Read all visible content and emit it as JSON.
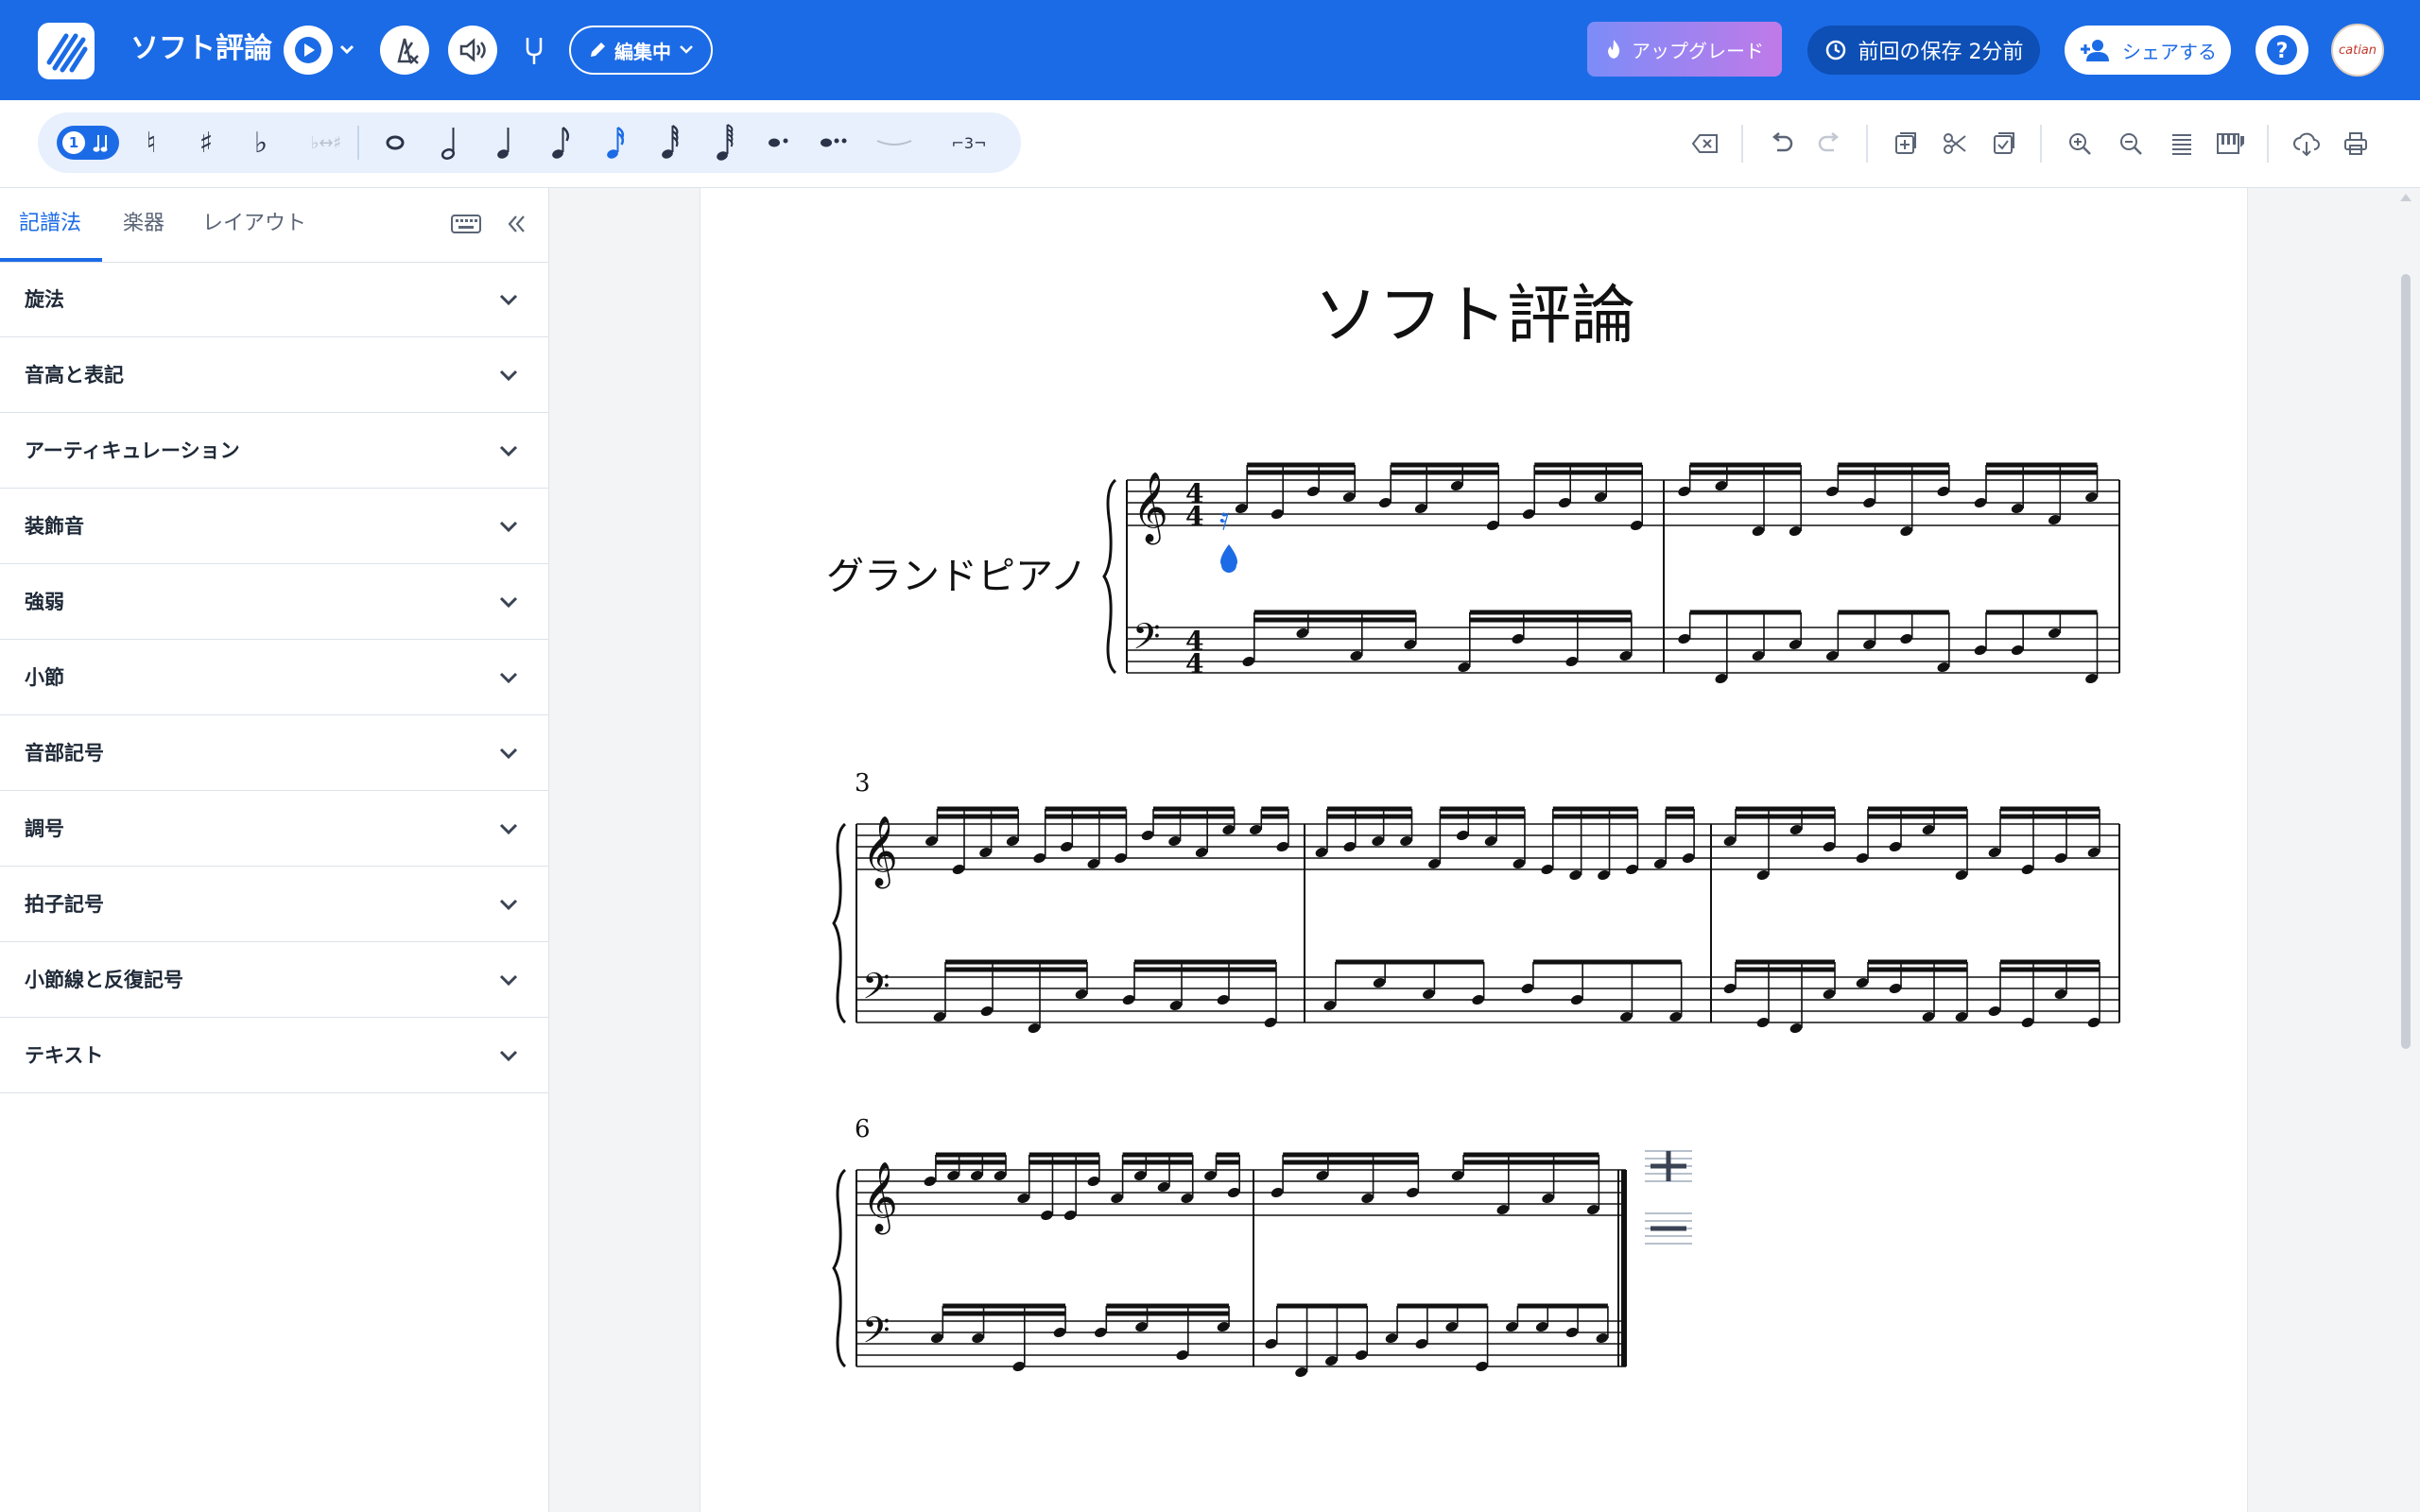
{
  "app": {
    "title": "ソフト評論",
    "edit_mode": "編集中",
    "upgrade": "アップグレード",
    "last_saved": "前回の保存 2分前",
    "share": "シェアする",
    "avatar_text": "catian",
    "accent": "#1c6be6"
  },
  "toolbar": {
    "voice_badge": "1",
    "tools": [
      "natural-icon",
      "sharp-icon",
      "flat-icon",
      "enharmonic-icon",
      "whole-note-icon",
      "half-note-icon",
      "quarter-note-icon",
      "eighth-note-icon",
      "sixteenth-note-icon",
      "32nd-note-icon",
      "64th-note-icon",
      "dot-icon",
      "double-dot-icon",
      "tie-icon",
      "tuplet-icon"
    ],
    "tuplet_label": "⌐3¬",
    "natural": "♮",
    "sharp": "♯",
    "flat": "♭",
    "enharmonic": "♭↔♯"
  },
  "sidebar": {
    "tabs": [
      "記譜法",
      "楽器",
      "レイアウト"
    ],
    "active_tab": "記譜法",
    "sections": [
      "旋法",
      "音高と表記",
      "アーティキュレーション",
      "装飾音",
      "強弱",
      "小節",
      "音部記号",
      "調号",
      "拍子記号",
      "小節線と反復記号",
      "テキスト"
    ]
  },
  "score": {
    "title": "ソフト評論",
    "instrument": "グランドピアノ",
    "time_signature": "4/4",
    "measure_numbers": [
      "3",
      "6"
    ],
    "selection_color": "#1c6be6"
  }
}
